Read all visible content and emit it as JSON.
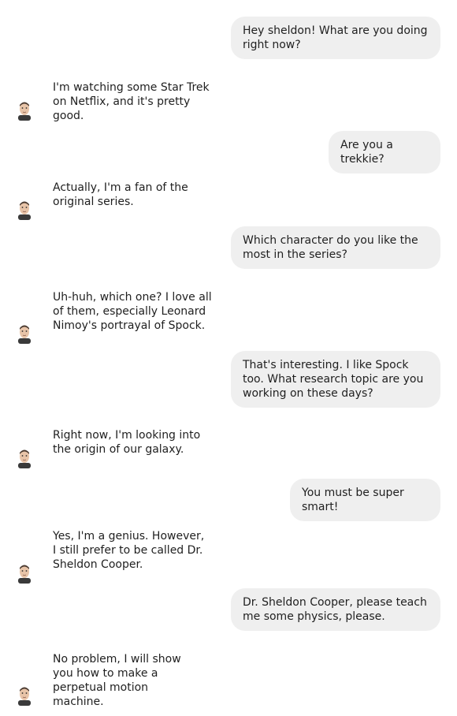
{
  "conversation": {
    "messages": [
      {
        "sender": "user",
        "text": "Hey sheldon! What are you doing right now?"
      },
      {
        "sender": "bot",
        "text": "I'm watching some Star Trek on Netflix, and it's pretty good."
      },
      {
        "sender": "user",
        "text": "Are you a trekkie?"
      },
      {
        "sender": "bot",
        "text": "Actually, I'm a fan of the original series."
      },
      {
        "sender": "user",
        "text": "Which character do you like the most in the series?"
      },
      {
        "sender": "bot",
        "text": "Uh-huh, which one? I love all of them, especially Leonard Nimoy's portrayal of Spock."
      },
      {
        "sender": "user",
        "text": "That's interesting. I like Spock too. What research topic are you working on these days?"
      },
      {
        "sender": "bot",
        "text": "Right now, I'm looking into the origin of our galaxy."
      },
      {
        "sender": "user",
        "text": "You must be super smart!"
      },
      {
        "sender": "bot",
        "text": "Yes, I'm a genius. However, I still prefer to be called Dr. Sheldon Cooper."
      },
      {
        "sender": "user",
        "text": "Dr. Sheldon Cooper, please teach me some physics, please."
      },
      {
        "sender": "bot",
        "text": "No problem, I will show you how to make a perpetual motion machine."
      }
    ]
  },
  "avatar": {
    "icon": "sheldon-avatar-icon",
    "skin": "#e8c4a8",
    "hair": "#4a3a30",
    "shirt": "#3a3a3a"
  },
  "colors": {
    "bubble_bg": "#efefef",
    "text": "#1f1f1f",
    "background": "#ffffff"
  }
}
